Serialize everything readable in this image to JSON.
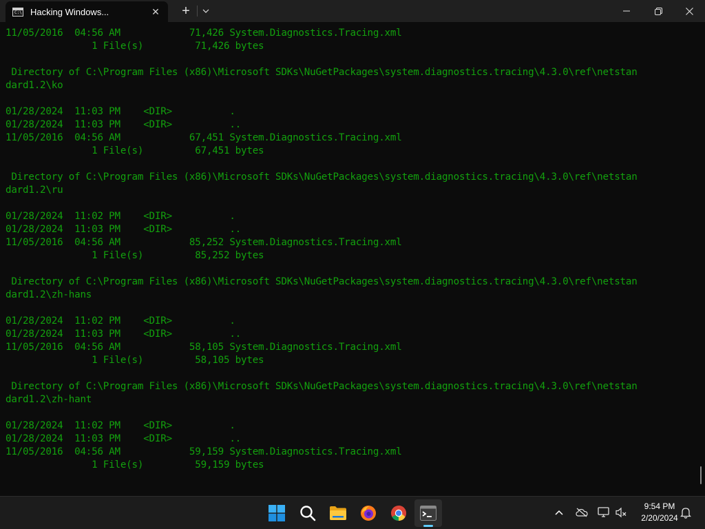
{
  "window": {
    "tab_title": "Hacking Windows...",
    "tab_icon_text": "C:\\",
    "close_tab_glyph": "✕",
    "new_tab_glyph": "+",
    "dropdown_glyph": "⌄",
    "minimize_glyph": "—",
    "maximize_glyph": "❐",
    "close_glyph": "✕"
  },
  "terminal": {
    "lines": [
      "11/05/2016  04:56 AM            71,426 System.Diagnostics.Tracing.xml",
      "               1 File(s)         71,426 bytes",
      "",
      " Directory of C:\\Program Files (x86)\\Microsoft SDKs\\NuGetPackages\\system.diagnostics.tracing\\4.3.0\\ref\\netstan",
      "dard1.2\\ko",
      "",
      "01/28/2024  11:03 PM    <DIR>          .",
      "01/28/2024  11:03 PM    <DIR>          ..",
      "11/05/2016  04:56 AM            67,451 System.Diagnostics.Tracing.xml",
      "               1 File(s)         67,451 bytes",
      "",
      " Directory of C:\\Program Files (x86)\\Microsoft SDKs\\NuGetPackages\\system.diagnostics.tracing\\4.3.0\\ref\\netstan",
      "dard1.2\\ru",
      "",
      "01/28/2024  11:02 PM    <DIR>          .",
      "01/28/2024  11:03 PM    <DIR>          ..",
      "11/05/2016  04:56 AM            85,252 System.Diagnostics.Tracing.xml",
      "               1 File(s)         85,252 bytes",
      "",
      " Directory of C:\\Program Files (x86)\\Microsoft SDKs\\NuGetPackages\\system.diagnostics.tracing\\4.3.0\\ref\\netstan",
      "dard1.2\\zh-hans",
      "",
      "01/28/2024  11:02 PM    <DIR>          .",
      "01/28/2024  11:03 PM    <DIR>          ..",
      "11/05/2016  04:56 AM            58,105 System.Diagnostics.Tracing.xml",
      "               1 File(s)         58,105 bytes",
      "",
      " Directory of C:\\Program Files (x86)\\Microsoft SDKs\\NuGetPackages\\system.diagnostics.tracing\\4.3.0\\ref\\netstan",
      "dard1.2\\zh-hant",
      "",
      "01/28/2024  11:02 PM    <DIR>          .",
      "01/28/2024  11:03 PM    <DIR>          ..",
      "11/05/2016  04:56 AM            59,159 System.Diagnostics.Tracing.xml",
      "               1 File(s)         59,159 bytes"
    ],
    "text_color": "#13a10e",
    "background": "#0c0c0c"
  },
  "taskbar": {
    "apps": [
      {
        "name": "start-button",
        "icon": "windows-logo-icon"
      },
      {
        "name": "search-button",
        "icon": "search-icon"
      },
      {
        "name": "file-explorer-button",
        "icon": "folder-icon"
      },
      {
        "name": "firefox-button",
        "icon": "firefox-icon"
      },
      {
        "name": "chrome-button",
        "icon": "chrome-icon"
      },
      {
        "name": "terminal-button",
        "icon": "terminal-icon",
        "active": true
      }
    ],
    "tray": {
      "chevron_glyph": "^",
      "time": "9:54 PM",
      "date": "2/20/2024"
    },
    "accent": "#60cdff"
  }
}
